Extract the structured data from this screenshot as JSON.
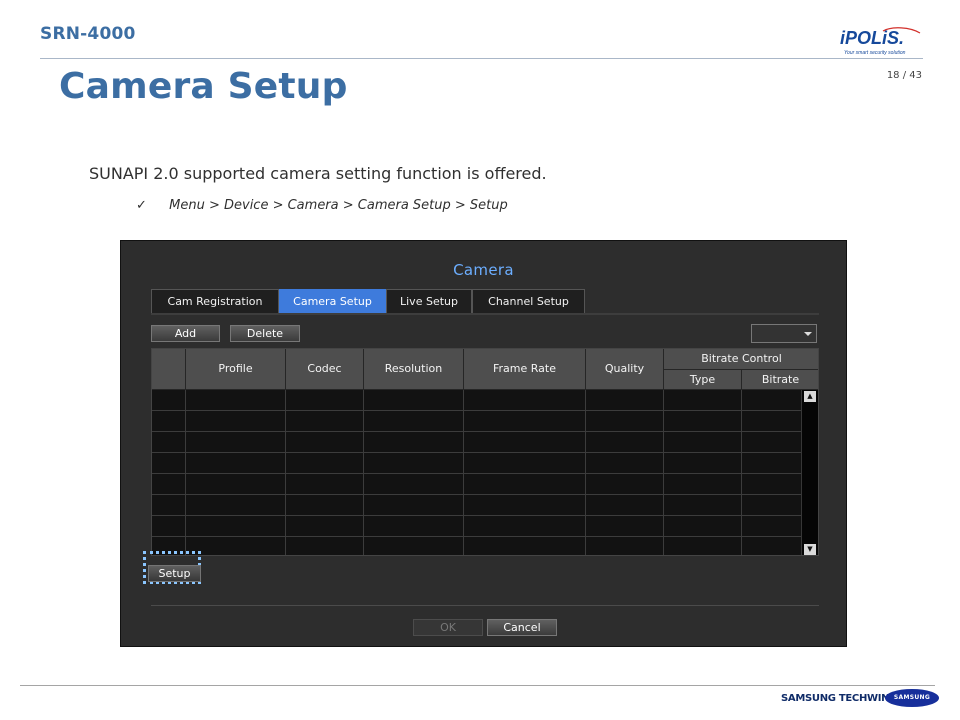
{
  "slide": {
    "model": "SRN-4000",
    "brand": {
      "logo": "iPOLiS.",
      "tagline": "Your smart security solution"
    },
    "page": "18 / 43",
    "title": "Camera Setup",
    "description": "SUNAPI 2.0 supported camera setting function is offered.",
    "menu_path_check": "✓",
    "menu_path": "Menu > Device > Camera > Camera Setup > Setup",
    "footer_company": "SAMSUNG TECHWIN",
    "footer_logo": "SAMSUNG"
  },
  "dialog": {
    "title": "Camera",
    "tabs": [
      {
        "label": "Cam Registration",
        "active": false
      },
      {
        "label": "Camera Setup",
        "active": true
      },
      {
        "label": "Live Setup",
        "active": false
      },
      {
        "label": "Channel Setup",
        "active": false
      }
    ],
    "actions": {
      "add": "Add",
      "delete": "Delete"
    },
    "columns": {
      "profile": "Profile",
      "codec": "Codec",
      "resolution": "Resolution",
      "frame_rate": "Frame Rate",
      "quality": "Quality",
      "bitrate_control": "Bitrate Control",
      "type": "Type",
      "bitrate": "Bitrate"
    },
    "rows": [
      [
        "",
        "",
        "",
        "",
        "",
        "",
        "",
        ""
      ],
      [
        "",
        "",
        "",
        "",
        "",
        "",
        "",
        ""
      ],
      [
        "",
        "",
        "",
        "",
        "",
        "",
        "",
        ""
      ],
      [
        "",
        "",
        "",
        "",
        "",
        "",
        "",
        ""
      ],
      [
        "",
        "",
        "",
        "",
        "",
        "",
        "",
        ""
      ],
      [
        "",
        "",
        "",
        "",
        "",
        "",
        "",
        ""
      ],
      [
        "",
        "",
        "",
        "",
        "",
        "",
        "",
        ""
      ],
      [
        "",
        "",
        "",
        "",
        "",
        "",
        "",
        ""
      ]
    ],
    "setup": "Setup",
    "ok": "OK",
    "cancel": "Cancel",
    "scroll_up_icon": "▲",
    "scroll_down_icon": "▼"
  },
  "colors": {
    "title_blue": "#3c6ea3",
    "active_tab": "#3e7bdc",
    "dialog_title": "#6caeff",
    "focus_frame": "#8bc6ff"
  }
}
